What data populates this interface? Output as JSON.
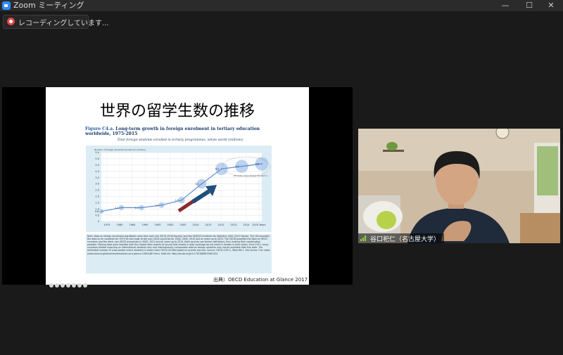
{
  "window": {
    "title": "Zoom ミーティング"
  },
  "recording": {
    "label": "レコーディングしています..."
  },
  "slide": {
    "title": "世界の留学生数の推移",
    "figure_label": "Figure C4.a.",
    "figure_title": "Long-term growth in foreign enrolment in tertiary education worldwide, 1975-2015",
    "figure_subtitle": "Total foreign students enrolled in tertiary programmes, whole world (millions)",
    "y_axis_caption": "Number of foreign students enrolled (in millions)",
    "annotation": "25 million more foreign student in...",
    "source_credit": "出典）OECD Education at Glance 2017",
    "note_text": "Note: Data on foreign enrolment worldwide come from both the OECD (2016 figures) and the UNESCO Institute for Statistics (UIS) (2015 figure). The UIS provided the data on all countries for 1975-95 and most of the non-OECD countries for 2000, 2005, 2010 and all years up to 2015. The OECD provided the data on OECD countries and the other non-OECD economies in 2000, 2011 and all years up to 2014. Both sources use similar definitions, thus making their combination possible. Missing data were imputed with the closest data reports to ensure that breaks in data coverage do not result in breaks in time series. From 2013, many countries started reporting on international students only and internationally comparable data on foreign students may not be available after this date. The estimated number of cross-border online students is drawn from OECD (2016b) based on private sources. Source: OECD (2017), Table B6.1. See Annex 3 for notes (www.oecd.org/education/education-at-a-glance-19991487.htm). StatLink: http://dx.doi.org/10.1787/888933561434"
  },
  "chart_data": {
    "type": "line",
    "title": "Long-term growth in foreign enrolment in tertiary education worldwide, 1975-2015",
    "ylabel": "Number of foreign students enrolled (in millions)",
    "x": [
      1975,
      1980,
      1985,
      1990,
      1995,
      2000,
      2005,
      2010,
      2011,
      2012,
      2013,
      2014,
      2015
    ],
    "x_ticks": [
      "1975",
      "1980",
      "1985",
      "1990",
      "1995",
      "2000",
      "2005",
      "2010",
      "2015",
      "2012",
      "2013",
      "2014",
      "2015 Years"
    ],
    "ylim": [
      0,
      5.5
    ],
    "y_ticks": [
      "0",
      "0.5",
      "1.0",
      "1.5",
      "2.0",
      "2.5",
      "3.0",
      "3.5",
      "4.0",
      "4.5",
      "5.0",
      "5.5"
    ],
    "points": [
      {
        "x": 1975,
        "y": 0.8,
        "label": "0.8"
      },
      {
        "x": 1980,
        "y": 1.1,
        "label": "1.1"
      },
      {
        "x": 1985,
        "y": 1.1,
        "label": "1.1"
      },
      {
        "x": 1990,
        "y": 1.3,
        "label": "1.3"
      },
      {
        "x": 1995,
        "y": 1.7,
        "label": "1.7"
      },
      {
        "x": 2000,
        "y": 3.0,
        "label": "3.0"
      },
      {
        "x": 2005,
        "y": 4.2,
        "label": "4.2"
      },
      {
        "x": 2010,
        "y": 4.4,
        "label": "4.4"
      },
      {
        "x": 2015,
        "y": 4.6,
        "label": "4.6"
      }
    ],
    "grid": true,
    "colors": {
      "line": "#5b8fd6",
      "bubble": "#a8c4e8",
      "arrow": "#1f4e7a",
      "arrow_tail": "#8b2a2a",
      "plot_bg": "#ffffff",
      "panel_bg": "#dcecf5"
    }
  },
  "participant": {
    "name": "谷口祀仁（名古屋大学）"
  },
  "colors": {
    "accent": "#2d8cff",
    "recording": "#e04545",
    "audio": "#8bd33a"
  }
}
